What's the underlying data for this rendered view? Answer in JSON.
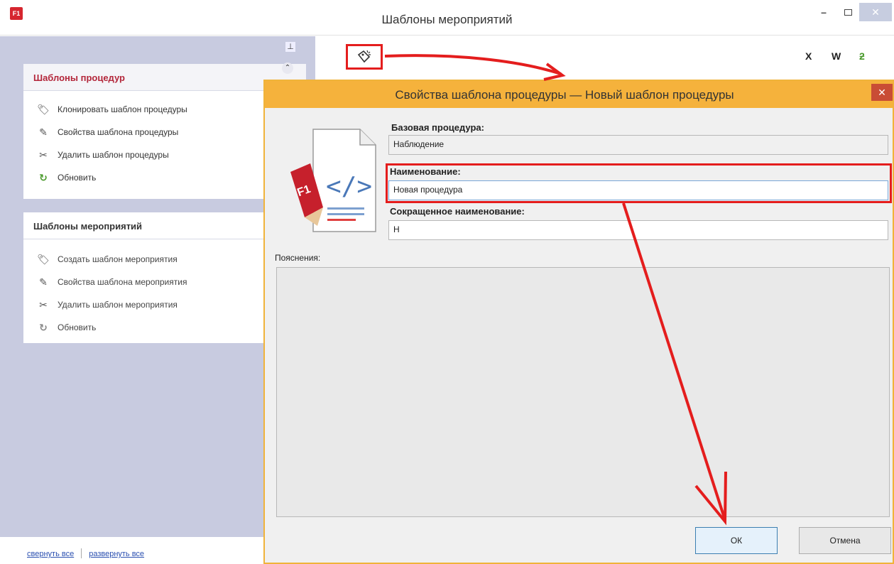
{
  "window": {
    "logo_text": "F1",
    "title": "Шаблоны мероприятий",
    "min_glyph": "–",
    "close_glyph": "✕"
  },
  "left_panel": {
    "pin_glyph": "⊥",
    "collapse_glyph": "⌃",
    "group1": {
      "title": "Шаблоны процедур",
      "items": [
        {
          "label": "Клонировать шаблон процедуры",
          "icon": "clone-icon"
        },
        {
          "label": "Свойства шаблона процедуры",
          "icon": "properties-icon"
        },
        {
          "label": "Удалить шаблон процедуры",
          "icon": "delete-icon"
        },
        {
          "label": "Обновить",
          "icon": "refresh-icon"
        }
      ]
    },
    "group2": {
      "title": "Шаблоны мероприятий",
      "items": [
        {
          "label": "Создать шаблон мероприятия",
          "icon": "create-icon"
        },
        {
          "label": "Свойства шаблона мероприятия",
          "icon": "properties-icon"
        },
        {
          "label": "Удалить шаблон мероприятия",
          "icon": "delete-icon"
        },
        {
          "label": "Обновить",
          "icon": "refresh-icon"
        }
      ]
    },
    "collapse_all": "свернуть все",
    "expand_all": "развернуть все"
  },
  "toolbar": {
    "new_template_icon": "tag-add-icon",
    "x_label": "X",
    "w_label": "W",
    "refresh_glyph": "ƻ"
  },
  "dialog": {
    "title": "Свойства шаблона процедуры — Новый шаблон процедуры",
    "close_glyph": "✕",
    "base_label": "Базовая процедура:",
    "base_value": "Наблюдение",
    "name_label": "Наименование:",
    "name_value": "Новая процедура",
    "short_label": "Сокращенное наименование:",
    "short_value": "Н",
    "notes_label": "Пояснения:",
    "ok_label": "ОК",
    "cancel_label": "Отмена"
  },
  "colors": {
    "highlight": "#e41d1d",
    "dialog_frame": "#f5b23c",
    "panel_bg": "#c8cbe0"
  }
}
